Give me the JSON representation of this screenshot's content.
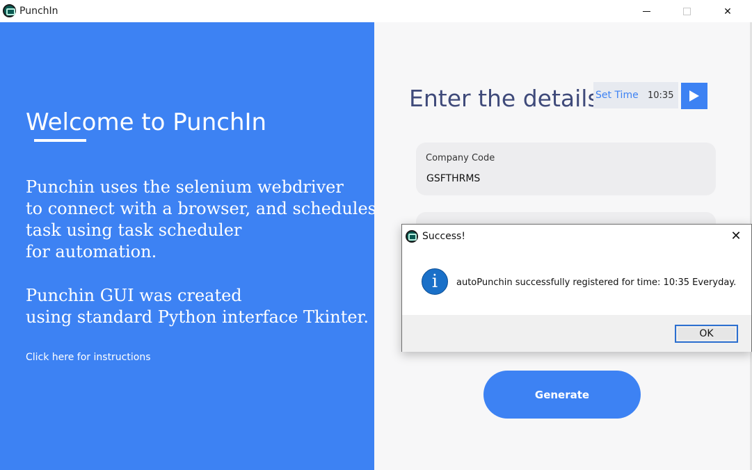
{
  "window": {
    "title": "PunchIn",
    "close_symbol": "✕"
  },
  "left": {
    "welcome": "Welcome to PunchIn",
    "paragraph1": "Punchin uses the selenium webdriver\nto connect with a browser, and schedules\ntask using task scheduler\nfor automation.",
    "paragraph2": "Punchin GUI was created\nusing standard Python interface Tkinter.",
    "instructions_link": "Click here for instructions"
  },
  "right": {
    "heading": "Enter the details.",
    "set_time_label": "Set Time",
    "set_time_value": "10:35",
    "fields": [
      {
        "label": "Company Code",
        "value": "GSFTHRMS"
      }
    ],
    "generate_label": "Generate"
  },
  "dialog": {
    "title": "Success!",
    "info_glyph": "i",
    "message": "autoPunchin successfully registered for time: 10:35 Everyday.",
    "ok_label": "OK",
    "close_symbol": "✕"
  },
  "colors": {
    "accent": "#3d82f3",
    "heading": "#3f4a7a",
    "info_icon": "#1a70c8"
  }
}
